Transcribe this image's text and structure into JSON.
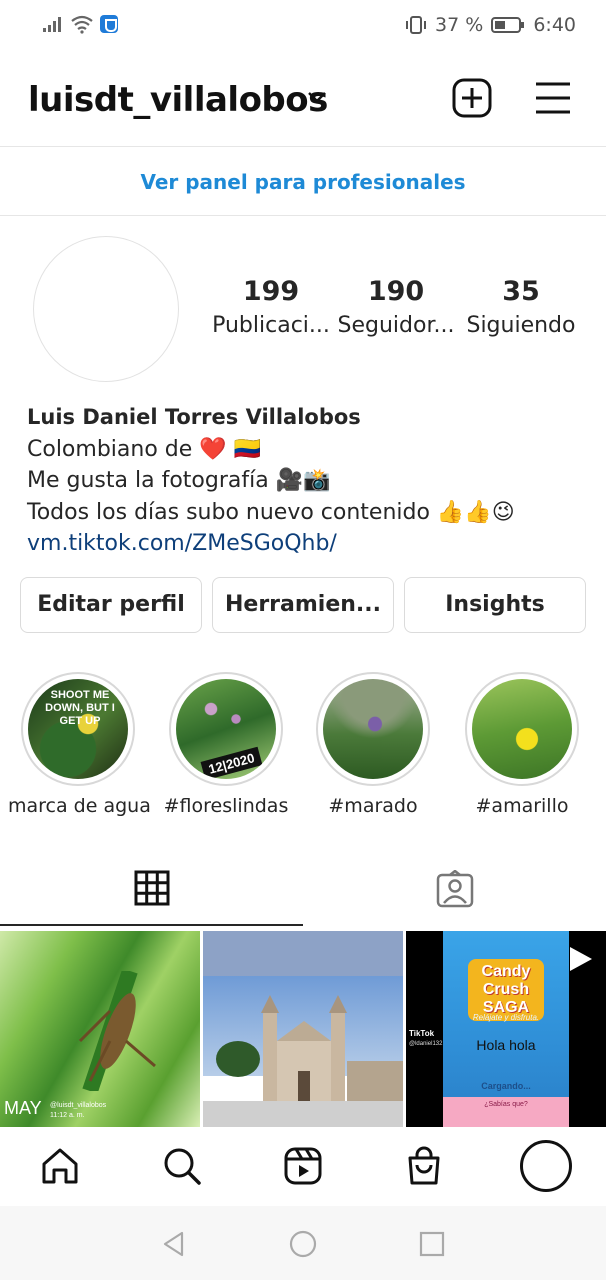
{
  "status_bar": {
    "battery_percent": "37 %",
    "time": "6:40"
  },
  "header": {
    "username": "luisdt_villalobos"
  },
  "pro_panel": {
    "label": "Ver panel para profesionales"
  },
  "stats": [
    {
      "value": "199",
      "label": "Publicaci..."
    },
    {
      "value": "190",
      "label": "Seguidor..."
    },
    {
      "value": "35",
      "label": "Siguiendo"
    }
  ],
  "bio": {
    "name": "Luis Daniel Torres Villalobos",
    "line1": "Colombiano de ❤️ 🇨🇴",
    "line2": "Me gusta la fotografía 🎥📸",
    "line3": "Todos los días subo nuevo contenido 👍👍😉",
    "link": "vm.tiktok.com/ZMeSGoQhb/"
  },
  "buttons": {
    "edit": "Editar perfil",
    "tools": "Herramien...",
    "insights": "Insights"
  },
  "highlights": [
    {
      "label": "marca de agua",
      "overlay": "SHOOT ME DOWN, BUT I GET UP"
    },
    {
      "label": "#floreslindas",
      "overlay": "12|2020"
    },
    {
      "label": "#marado"
    },
    {
      "label": "#amarillo"
    }
  ],
  "posts": [
    {
      "caption": "MAY",
      "sub": "@luisdt_villalobos",
      "time": "11:12 a. m."
    },
    {
      "caption": ""
    },
    {
      "tiktok": "TikTok",
      "handle": "@ldaniel132",
      "brand": "Candy Crush SAGA",
      "tagline": "Relájate y disfruta.",
      "text": "Hola hola",
      "loading": "Cargando...",
      "question": "¿Sabías que?"
    }
  ],
  "colors": {
    "accent_link": "#1e8ad6",
    "bio_link": "#0e3f7a",
    "border": "#dbdbdb"
  }
}
